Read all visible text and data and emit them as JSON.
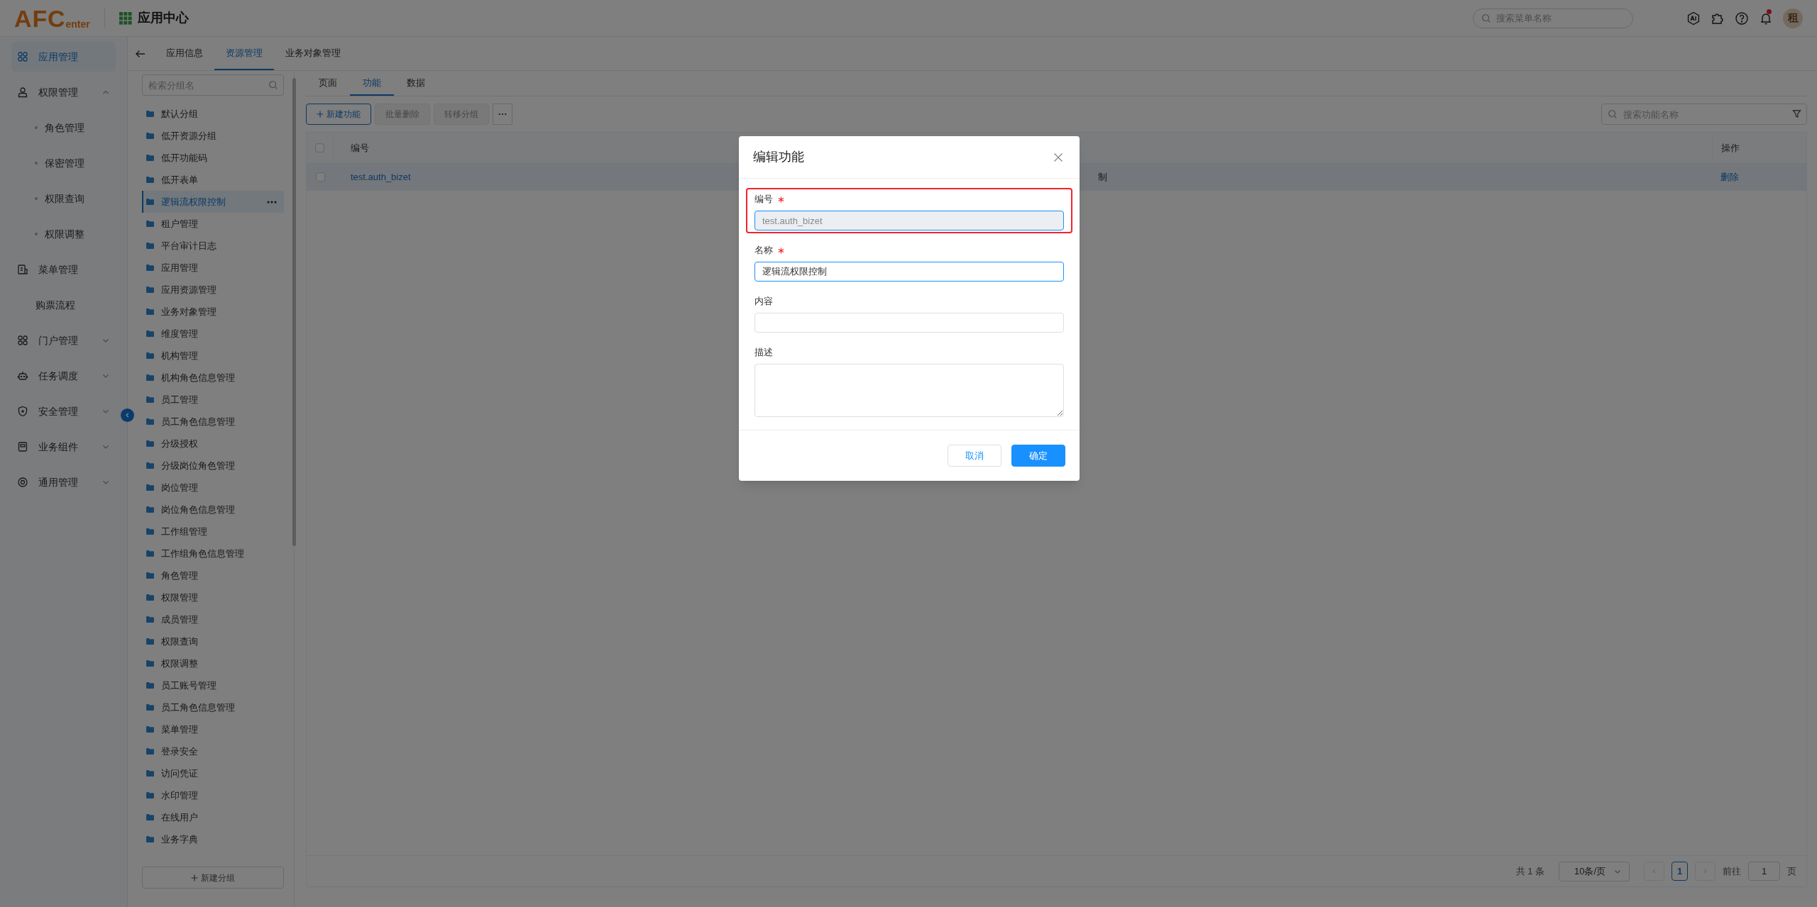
{
  "header": {
    "logo_main": "AFC",
    "logo_sub": "enter",
    "title": "应用中心",
    "search": {
      "placeholder": "搜索菜单名称"
    },
    "notification_dot": true,
    "avatar": "租"
  },
  "nav": {
    "items": [
      {
        "label": "应用管理",
        "kind": "plain",
        "selected": true
      },
      {
        "label": "权限管理",
        "kind": "group",
        "selected": false,
        "expanded": true,
        "children": [
          {
            "label": "角色管理",
            "selected": false
          },
          {
            "label": "保密管理",
            "selected": false
          },
          {
            "label": "权限查询",
            "selected": false
          },
          {
            "label": "权限调整",
            "selected": false
          }
        ]
      },
      {
        "label": "菜单管理",
        "kind": "plain",
        "selected": false
      },
      {
        "label": "购票流程",
        "kind": "bare",
        "selected": false
      },
      {
        "label": "门户管理",
        "kind": "group",
        "selected": false,
        "expanded": false
      },
      {
        "label": "任务调度",
        "kind": "group",
        "selected": false,
        "expanded": false
      },
      {
        "label": "安全管理",
        "kind": "group",
        "selected": false,
        "expanded": false
      },
      {
        "label": "业务组件",
        "kind": "group",
        "selected": false,
        "expanded": false
      },
      {
        "label": "通用管理",
        "kind": "group",
        "selected": false,
        "expanded": false
      }
    ]
  },
  "tabs": [
    {
      "label": "应用信息",
      "selected": false
    },
    {
      "label": "资源管理",
      "selected": true
    },
    {
      "label": "业务对象管理",
      "selected": false
    }
  ],
  "groups": {
    "search": {
      "placeholder": "检索分组名"
    },
    "items": [
      {
        "label": "默认分组",
        "selected": false
      },
      {
        "label": "低开资源分组",
        "selected": false
      },
      {
        "label": "低开功能码",
        "selected": false
      },
      {
        "label": "低开表单",
        "selected": false
      },
      {
        "label": "逻辑流权限控制",
        "selected": true
      },
      {
        "label": "租户管理",
        "selected": false
      },
      {
        "label": "平台审计日志",
        "selected": false
      },
      {
        "label": "应用管理",
        "selected": false
      },
      {
        "label": "应用资源管理",
        "selected": false
      },
      {
        "label": "业务对象管理",
        "selected": false
      },
      {
        "label": "维度管理",
        "selected": false
      },
      {
        "label": "机构管理",
        "selected": false
      },
      {
        "label": "机构角色信息管理",
        "selected": false
      },
      {
        "label": "员工管理",
        "selected": false
      },
      {
        "label": "员工角色信息管理",
        "selected": false
      },
      {
        "label": "分级授权",
        "selected": false
      },
      {
        "label": "分级岗位角色管理",
        "selected": false
      },
      {
        "label": "岗位管理",
        "selected": false
      },
      {
        "label": "岗位角色信息管理",
        "selected": false
      },
      {
        "label": "工作组管理",
        "selected": false
      },
      {
        "label": "工作组角色信息管理",
        "selected": false
      },
      {
        "label": "角色管理",
        "selected": false
      },
      {
        "label": "权限管理",
        "selected": false
      },
      {
        "label": "成员管理",
        "selected": false
      },
      {
        "label": "权限查询",
        "selected": false
      },
      {
        "label": "权限调整",
        "selected": false
      },
      {
        "label": "员工账号管理",
        "selected": false
      },
      {
        "label": "员工角色信息管理",
        "selected": false
      },
      {
        "label": "菜单管理",
        "selected": false
      },
      {
        "label": "登录安全",
        "selected": false
      },
      {
        "label": "访问凭证",
        "selected": false
      },
      {
        "label": "水印管理",
        "selected": false
      },
      {
        "label": "在线用户",
        "selected": false
      },
      {
        "label": "业务字典",
        "selected": false
      }
    ],
    "add_button": "新建分组"
  },
  "subtabs": [
    {
      "label": "页面",
      "selected": false
    },
    {
      "label": "功能",
      "selected": true
    },
    {
      "label": "数据",
      "selected": false
    }
  ],
  "toolbar": {
    "buttons": [
      {
        "label": "新建功能",
        "kind": "primary",
        "disabled": false
      },
      {
        "label": "批量删除",
        "kind": "default",
        "disabled": true
      },
      {
        "label": "转移分组",
        "kind": "default",
        "disabled": true
      }
    ],
    "search": {
      "placeholder": "搜索功能名称"
    }
  },
  "table": {
    "all_checked": false,
    "columns": [
      {
        "label": "编号"
      },
      {
        "label": "操作"
      }
    ],
    "rows": [
      {
        "code": "test.auth_bizet",
        "column_3": "制",
        "action": "删除",
        "checked": false,
        "selected": true
      }
    ]
  },
  "pagination": {
    "total": "共 1 条",
    "page_size": "10条/页",
    "pages": [
      {
        "label": "1",
        "selected": true
      }
    ],
    "goto_label": "前往",
    "goto_value": "1",
    "goto_unit": "页"
  },
  "dialog": {
    "mask": true,
    "title": "编辑功能",
    "fields": [
      {
        "kind": "input",
        "label": "编号",
        "required": true,
        "value": "test.auth_bizet",
        "disabled": true,
        "highlighted": true,
        "focused": false
      },
      {
        "kind": "input",
        "label": "名称",
        "required": true,
        "value": "逻辑流权限控制",
        "disabled": false,
        "highlighted": false,
        "focused": true
      },
      {
        "kind": "input",
        "label": "内容",
        "required": false,
        "disabled": false,
        "highlighted": false,
        "focused": false
      },
      {
        "kind": "textarea",
        "label": "描述",
        "required": false,
        "disabled": false,
        "highlighted": false,
        "focused": false
      }
    ],
    "buttons": [
      {
        "label": "取消",
        "kind": "default"
      },
      {
        "label": "确定",
        "kind": "primary"
      }
    ]
  }
}
